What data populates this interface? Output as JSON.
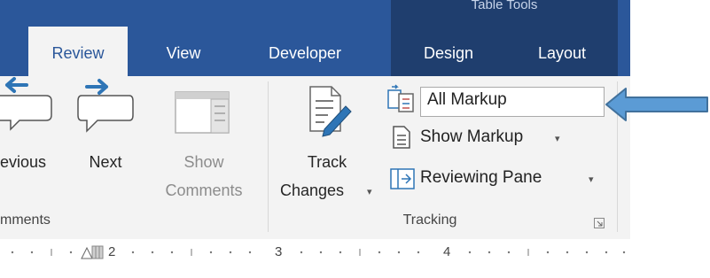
{
  "context_tab_group": "Table Tools",
  "tabs": [
    {
      "label": "Review",
      "active": true
    },
    {
      "label": "View",
      "active": false
    },
    {
      "label": "Developer",
      "active": false
    },
    {
      "label": "Design",
      "active": false
    },
    {
      "label": "Layout",
      "active": false
    }
  ],
  "comments_group": {
    "label": "mments",
    "previous_label": "evious",
    "next_label": "Next",
    "show_comments_line1": "Show",
    "show_comments_line2": "Comments"
  },
  "tracking_group": {
    "label": "Tracking",
    "track_changes_line1": "Track",
    "track_changes_line2": "Changes",
    "markup_select_value": "All Markup",
    "show_markup_label": "Show Markup",
    "reviewing_pane_label": "Reviewing Pane"
  },
  "ruler": {
    "marks": [
      "2",
      "3",
      "4"
    ]
  },
  "colors": {
    "ribbon_blue": "#2b579a",
    "context_blue": "#1f3e6e",
    "arrow_blue": "#5b9bd5"
  },
  "icons": [
    "previous-comment-icon",
    "next-comment-icon",
    "show-comments-icon",
    "track-changes-icon",
    "display-for-review-icon",
    "show-markup-icon",
    "reviewing-pane-icon",
    "dialog-launcher-icon",
    "callout-arrow"
  ]
}
